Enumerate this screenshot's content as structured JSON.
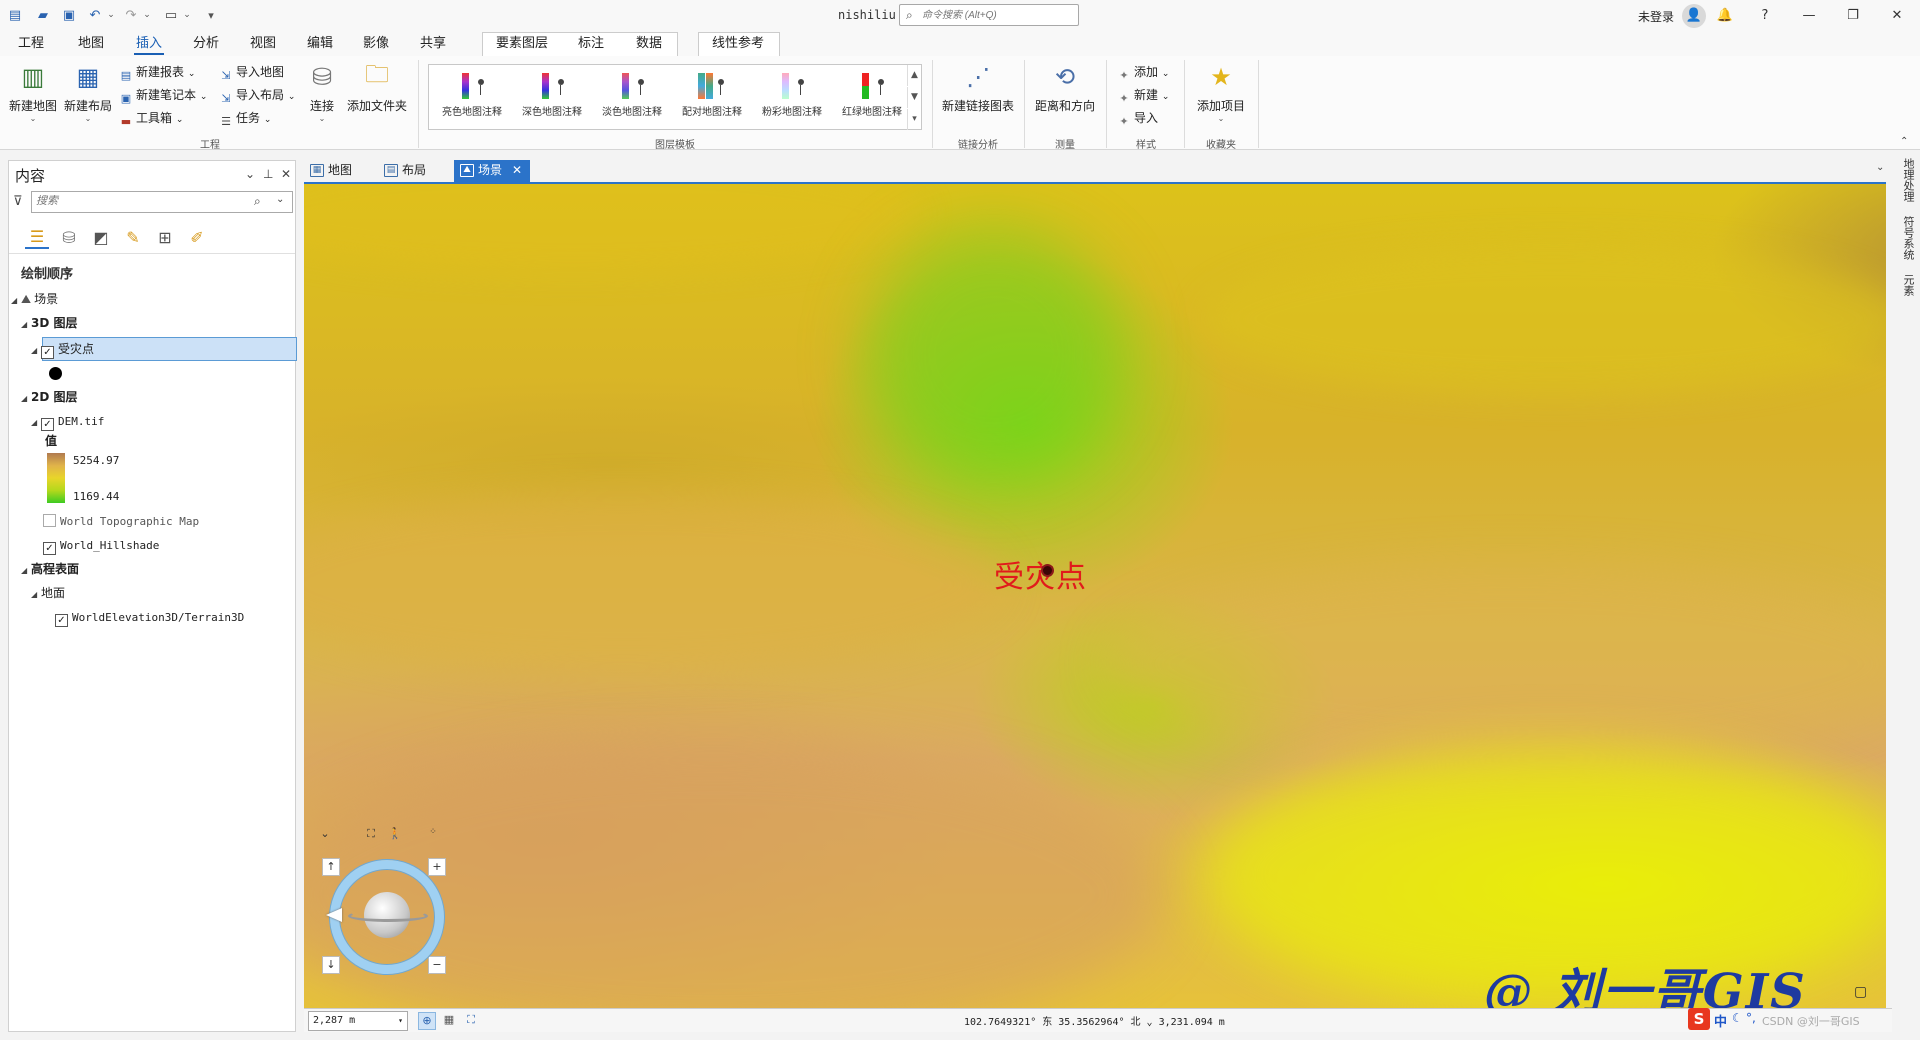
{
  "app": {
    "title": "nishiliu"
  },
  "search": {
    "placeholder": "命令搜索 (Alt+Q)"
  },
  "account": {
    "login": "未登录"
  },
  "ribbon": {
    "tabs": [
      "工程",
      "地图",
      "插入",
      "分析",
      "视图",
      "编辑",
      "影像",
      "共享"
    ],
    "context_tabs": [
      "要素图层",
      "标注",
      "数据"
    ],
    "context_tab2": "线性参考",
    "groups": {
      "project": {
        "label": "工程",
        "new_map": "新建地图",
        "new_layout": "新建布局",
        "new_report": "新建报表",
        "new_notebook": "新建笔记本",
        "toolbox": "工具箱",
        "import_map": "导入地图",
        "import_layout": "导入布局",
        "task": "任务",
        "connect": "连接",
        "add_folder": "添加文件夹"
      },
      "layer_templates": {
        "label": "图层模板",
        "items": [
          "亮色地图注释",
          "深色地图注释",
          "淡色地图注释",
          "配对地图注释",
          "粉彩地图注释",
          "红绿地图注释"
        ]
      },
      "link_analysis": {
        "label": "链接分析",
        "new_link_chart": "新建链接图表"
      },
      "measure": {
        "label": "测量",
        "distance": "距离和方向"
      },
      "styles": {
        "label": "样式",
        "add": "添加",
        "new": "新建",
        "import": "导入"
      },
      "favorites": {
        "label": "收藏夹",
        "add_item": "添加项目"
      }
    }
  },
  "contents": {
    "title": "内容",
    "search_placeholder": "搜索",
    "drawing_order": "绘制顺序",
    "scene": "场景",
    "layers3d": "3D 图层",
    "point_layer": "受灾点",
    "layers2d": "2D 图层",
    "dem": "DEM.tif",
    "value_label": "值",
    "max_value": "5254.97",
    "min_value": "1169.44",
    "topo": "World Topographic Map",
    "hillshade": "World_Hillshade",
    "elevation": "高程表面",
    "ground": "地面",
    "terrain": "WorldElevation3D/Terrain3D"
  },
  "view_tabs": [
    "地图",
    "布局",
    "场景"
  ],
  "scene": {
    "point_label": "受灾点",
    "watermark": "@ 刘一哥GIS"
  },
  "right_dock": [
    "地理处理",
    "符号系统",
    "元素"
  ],
  "status": {
    "scale": "2,287 m",
    "coords": "102.7649321° 东  35.3562964° 北  ⌄  3,231.094 m"
  },
  "ime": {
    "lang": "中",
    "csdn": "CSDN @刘一哥GIS"
  },
  "colors": {
    "accent": "#1a5fb4",
    "label_red": "#e11b1b",
    "selected_row": "#cce1f7"
  }
}
